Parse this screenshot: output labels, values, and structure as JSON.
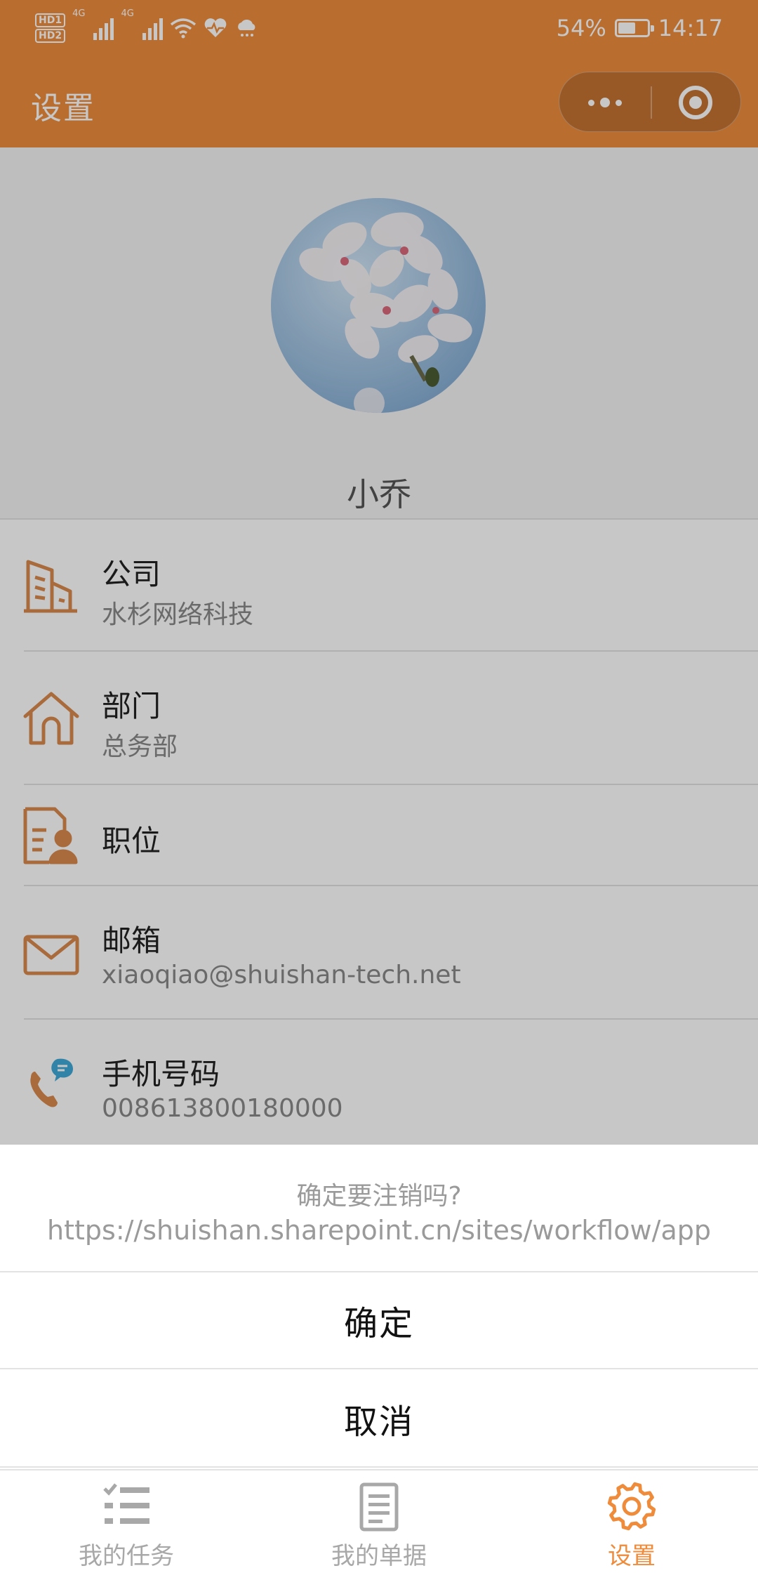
{
  "status_bar": {
    "sim1": "HD1",
    "sim2": "HD2",
    "network1": "4G",
    "network2": "4G",
    "battery_text": "54%",
    "battery_level": 0.54,
    "time": "14:17"
  },
  "nav": {
    "title": "设置"
  },
  "profile": {
    "name": "小乔"
  },
  "info": {
    "company": {
      "label": "公司",
      "value": "水杉网络科技",
      "icon": "building-icon"
    },
    "department": {
      "label": "部门",
      "value": "总务部",
      "icon": "home-icon"
    },
    "position": {
      "label": "职位",
      "icon": "id-card-icon"
    },
    "email": {
      "label": "邮箱",
      "value": "xiaoqiao@shuishan-tech.net",
      "icon": "mail-icon"
    },
    "phone": {
      "label": "手机号码",
      "value": "008613800180000",
      "icon": "phone-icon"
    }
  },
  "action_sheet": {
    "question": "确定要注销吗?",
    "url": "https://shuishan.sharepoint.cn/sites/workflow/app",
    "confirm_label": "确定",
    "cancel_label": "取消"
  },
  "tabbar": {
    "tasks_label": "我的任务",
    "docs_label": "我的单据",
    "settings_label": "设置"
  },
  "colors": {
    "accent": "#EE8C3C",
    "overlay": "rgba(0,0,0,0.22)"
  }
}
